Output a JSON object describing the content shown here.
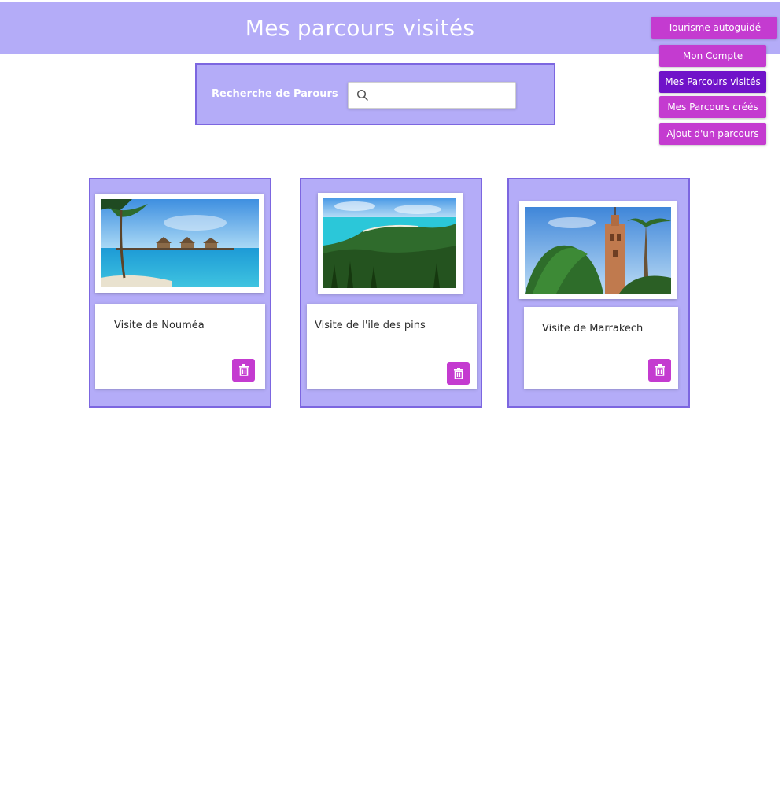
{
  "header": {
    "title": "Mes parcours visités"
  },
  "nav": {
    "brand": "Tourisme autoguidé",
    "items": [
      {
        "label": "Mon Compte",
        "active": false
      },
      {
        "label": "Mes Parcours visités",
        "active": true
      },
      {
        "label": "Mes Parcours créés",
        "active": false
      },
      {
        "label": "Ajout d'un parcours",
        "active": false
      }
    ]
  },
  "search": {
    "label": "Recherche de Parours",
    "value": "",
    "placeholder": ""
  },
  "cards": [
    {
      "title": "Visite de Nouméa",
      "image": "overwater-bungalows-beach"
    },
    {
      "title": "Visite de l'ile des pins",
      "image": "turquoise-lagoon-forest"
    },
    {
      "title": "Visite de Marrakech",
      "image": "koutoubia-minaret-palms"
    }
  ],
  "colors": {
    "header_bg": "#b4acf8",
    "card_border": "#7c66e0",
    "button_bg": "#c43bd0",
    "button_active": "#7013c9"
  },
  "icons": {
    "search": "search-icon",
    "delete": "trash-icon"
  }
}
